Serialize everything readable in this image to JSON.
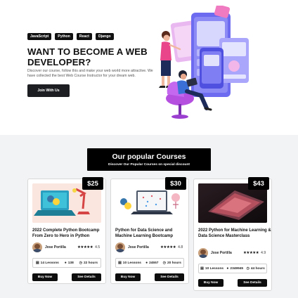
{
  "hero": {
    "tags": [
      "JavaScript",
      "Python",
      "React",
      "Django"
    ],
    "title": "WANT TO BECOME A WEB DEVELOPER?",
    "description": "Discover our course, follow this and make your web world more attractive. We have collected the best Web Course Instructor for your dream web.",
    "cta_label": "Join With Us"
  },
  "section": {
    "title": "Our popular Courses",
    "subtitle": "Discover Our Popular Courses on special discount"
  },
  "courses": [
    {
      "price": "$25",
      "title": "2022 Complete Python Bootcamp From Zero to Hero in Python",
      "author": "Jose Portilla",
      "stars": "★★★★★",
      "rating": "4.5",
      "lessons": "14 Lessons",
      "students": "138",
      "hours": "22 hours",
      "buy_label": "Buy Now",
      "details_label": "See Details",
      "image_icon": "python-laptop-illustration"
    },
    {
      "price": "$30",
      "title": "Python for Data Science and Machine Learning Bootcamp",
      "author": "Jose Portilla",
      "stars": "★★★★★",
      "rating": "4.8",
      "lessons": "10 Lessons",
      "students": "24557",
      "hours": "20 hours",
      "buy_label": "Buy Now",
      "details_label": "See Details",
      "image_icon": "data-science-illustration"
    },
    {
      "price": "$43",
      "title": "2022 Python for Machine Learning & Data Science Masterclass",
      "author": "Jose Portilla",
      "stars": "★★★★★",
      "rating": "4.9",
      "lessons": "10 Lessons",
      "students": "2349945",
      "hours": "44 hours",
      "buy_label": "Buy Now",
      "details_label": "See Details",
      "image_icon": "laptop-photo"
    }
  ],
  "colors": {
    "accent_purple": "#8b5cf6",
    "hero_pink": "#e8458b",
    "button_dark": "#1c1e21",
    "section_bg": "#f2f3f5"
  }
}
